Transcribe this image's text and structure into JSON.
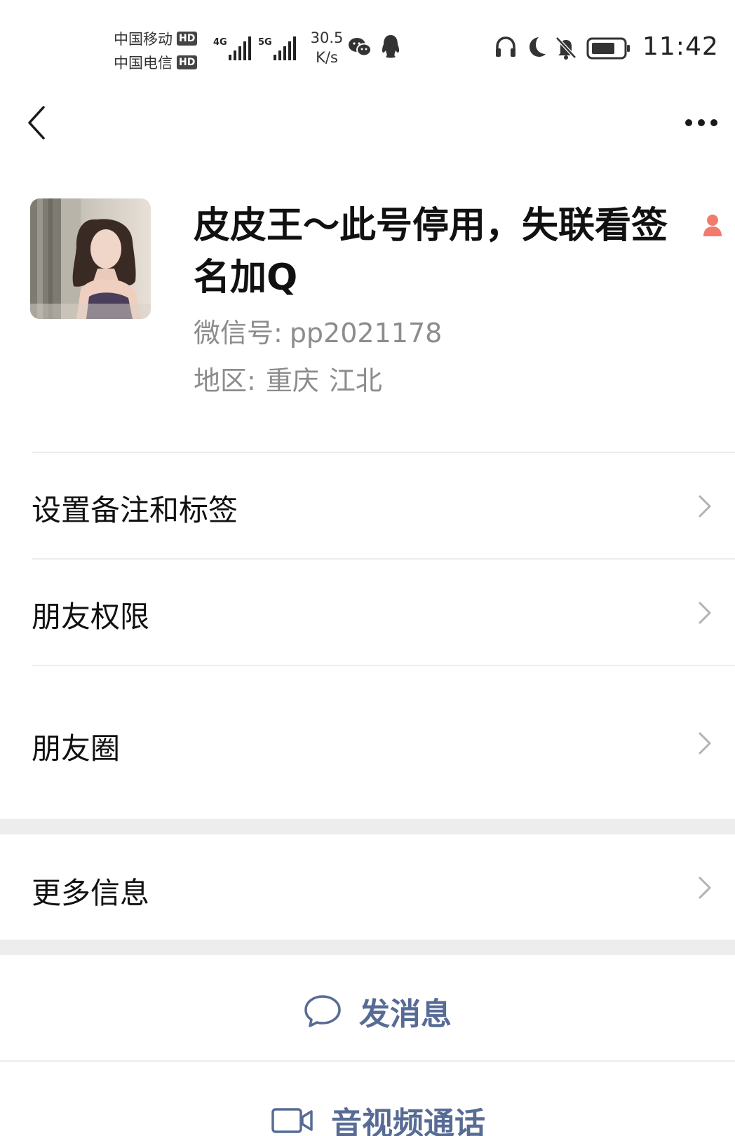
{
  "status_bar": {
    "carrier_1": "中国移动",
    "carrier_2": "中国电信",
    "hd": "HD",
    "network_1": "4G",
    "network_2": "5G",
    "speed_value": "30.5",
    "speed_unit": "K/s",
    "time": "11:42",
    "icons": [
      "wechat-icon",
      "qq-icon",
      "headphones-icon",
      "moon-icon",
      "bell-off-icon",
      "battery-icon"
    ]
  },
  "nav": {
    "back_icon": "chevron-left-icon",
    "more_icon": "more-dots-icon"
  },
  "profile": {
    "nickname": "皮皮王～此号停用，失联看签名加Q",
    "gender_icon": "female-icon",
    "wechat_id_label": "微信号:",
    "wechat_id": "pp2021178",
    "region_label": "地区:",
    "region_city": "重庆",
    "region_district": "江北"
  },
  "menu": {
    "items": [
      {
        "label": "设置备注和标签"
      },
      {
        "label": "朋友权限"
      },
      {
        "label": "朋友圈"
      },
      {
        "label": "更多信息"
      }
    ]
  },
  "actions": {
    "send_message": "发消息",
    "video_call": "音视频通话"
  },
  "colors": {
    "link_blue": "#576b95",
    "separator": "#ececec",
    "section_gap": "#ededed",
    "secondary_text": "#8c8c8c"
  }
}
